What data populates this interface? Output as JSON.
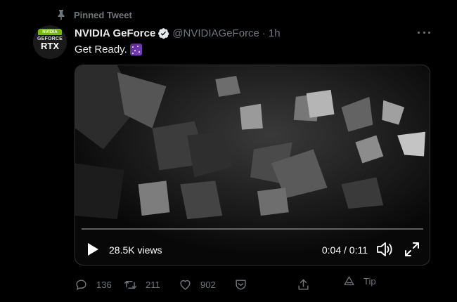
{
  "pinned": {
    "label": "Pinned Tweet",
    "icon": "pin-icon"
  },
  "tweet": {
    "avatar": {
      "badge": "NVIDIA",
      "line1": "GEFORCE",
      "line2": "RTX"
    },
    "display_name": "NVIDIA GeForce",
    "verified_icon": "verified-badge-icon",
    "handle": "@NVIDIAGeForce",
    "separator": "·",
    "time": "1h",
    "text": "Get Ready.",
    "emoji": "milky-way-emoji"
  },
  "video": {
    "views": "28.5K views",
    "timecode": "0:04 / 0:11",
    "progress": 0.0
  },
  "actions": {
    "reply_count": "136",
    "retweet_count": "211",
    "like_count": "902",
    "tip_label": "Tip"
  },
  "colors": {
    "background": "#000000",
    "text": "#e7e9ea",
    "muted": "#71767b",
    "nvidia_green": "#76b900",
    "verified": "#e7e9ea"
  }
}
